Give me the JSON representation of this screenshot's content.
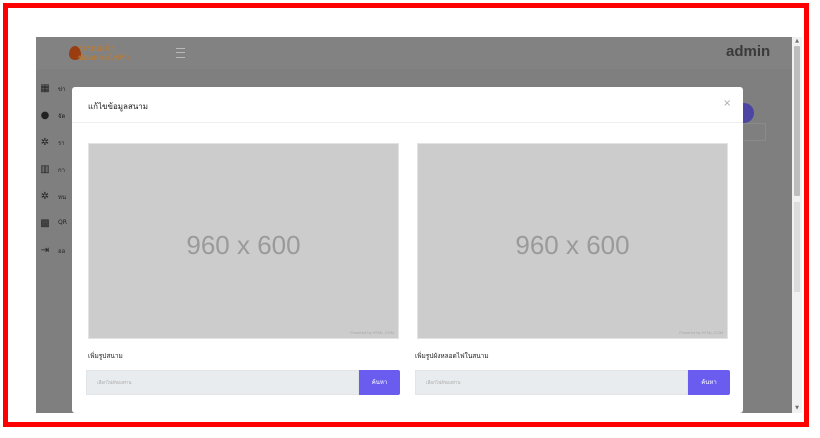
{
  "app": {
    "logo_line1": "ระบบแจ้ง",
    "logo_line2": "ซ่อมแซมไฟฟ้า",
    "user": "admin"
  },
  "sidebar": {
    "items": [
      {
        "icon": "dashboard-icon",
        "glyph": "▦",
        "label": "ข่า"
      },
      {
        "icon": "user-icon",
        "glyph": "●",
        "label": "จัด"
      },
      {
        "icon": "gear-icon",
        "glyph": "✲",
        "label": "รา"
      },
      {
        "icon": "chart-icon",
        "glyph": "▥",
        "label": "กา"
      },
      {
        "icon": "gear-icon",
        "glyph": "✲",
        "label": "หน"
      },
      {
        "icon": "qr-icon",
        "glyph": "▩",
        "label": "QR"
      },
      {
        "icon": "logout-icon",
        "glyph": "⇥",
        "label": "ออ"
      }
    ]
  },
  "modal": {
    "title": "แก้ไขข้อมูลสนาม",
    "close": "×",
    "left_image": {
      "dimensions": "960 x 600",
      "powered": "Powered by HTML.COM"
    },
    "right_image": {
      "dimensions": "960 x 600",
      "powered": "Powered by HTML.COM"
    },
    "left_label": "เพิ่มรูปสนาม",
    "right_label": "เพิ่มรูปผังหลอดไฟในสนาม",
    "left_placeholder": "เลือกไฟล์ของท่าน",
    "right_placeholder": "เลือกไฟล์ของท่าน",
    "left_button": "ค้นหา",
    "right_button": "ค้นหา"
  },
  "colors": {
    "frame": "#ff0000",
    "primary_button": "#6b5cf0",
    "overlay": "#7f7f7f"
  }
}
